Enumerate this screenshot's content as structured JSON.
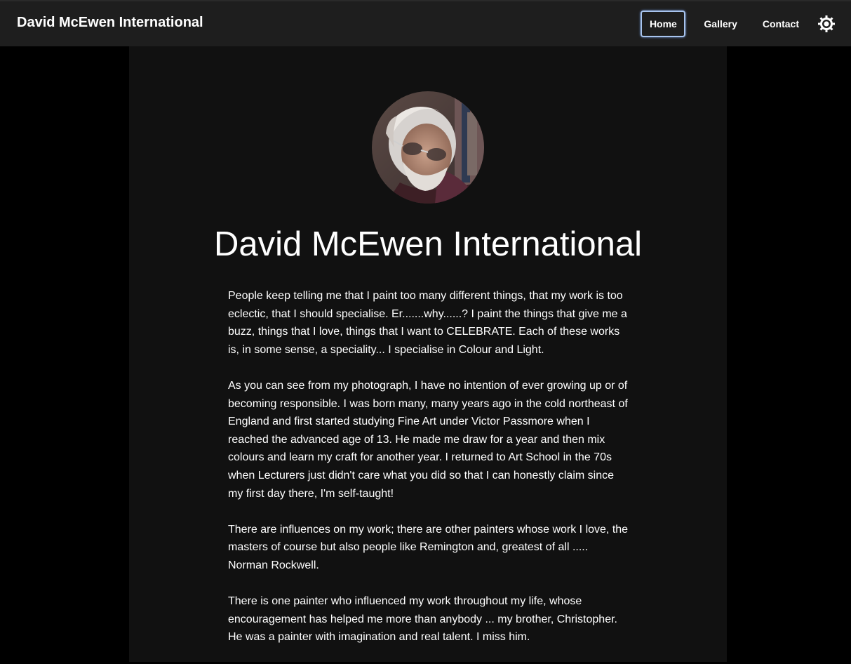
{
  "header": {
    "brand": "David McEwen International",
    "nav": {
      "home": "Home",
      "gallery": "Gallery",
      "contact": "Contact"
    },
    "theme_icon": "sun-icon"
  },
  "main": {
    "avatar_icon": "portrait-photo",
    "title": "David McEwen International",
    "paragraphs": [
      "People keep telling me that I paint too many different things, that my work is too eclectic, that I should specialise. Er.......why......? I paint the things that give me a buzz, things that I love, things that I want to CELEBRATE. Each of these works is, in some sense, a speciality... I specialise in Colour and Light.",
      "As you can see from my photograph, I have no intention of ever growing up or of becoming responsible. I was born many, many years ago in the cold northeast of England and first started studying Fine Art under Victor Passmore when I reached the advanced age of 13. He made me draw for a year and then mix colours and learn my craft for another year. I returned to Art School in the 70s when Lecturers just didn't care what you did so that I can honestly claim since my first day there, I'm self-taught!",
      "There are influences on my work; there are other painters whose work I love, the masters of course but also people like Remington and, greatest of all ..... Norman Rockwell.",
      "There is one painter who influenced my work throughout my life, whose encouragement has helped me more than anybody ... my brother, Christopher. He was a painter with imagination and real talent. I miss him."
    ]
  },
  "colors": {
    "page_bg": "#000000",
    "nav_bg": "#1e1e1e",
    "content_bg": "#111111",
    "text": "#ffffff",
    "active_border": "#a8c4ee"
  }
}
